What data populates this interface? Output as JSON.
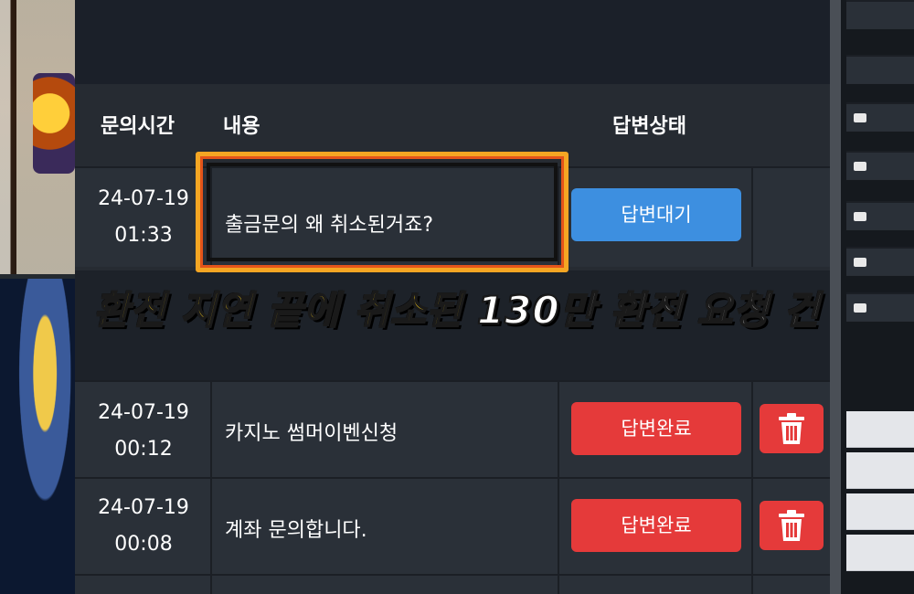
{
  "header": {
    "time_label": "문의시간",
    "content_label": "내용",
    "status_label": "답변상태"
  },
  "rows": [
    {
      "date": "24-07-19",
      "time": "01:33",
      "content": "출금문의 왜 취소된거죠?",
      "status": "답변대기",
      "status_color": "#3d8fe0",
      "deletable": false
    },
    {
      "date": "24-07-19",
      "time": "00:12",
      "content": "카지노 썸머이벤신청",
      "status": "답변완료",
      "status_color": "#e53a3a",
      "deletable": true
    },
    {
      "date": "24-07-19",
      "time": "00:08",
      "content": "계좌 문의합니다.",
      "status": "답변완료",
      "status_color": "#e53a3a",
      "deletable": true
    }
  ],
  "caption": {
    "yellow_part": "환전 지연 끝에 취소된",
    "white_part": "130만 환전 요청 건"
  },
  "icons": {
    "delete": "trash-icon"
  },
  "colors": {
    "highlight": "#f5a623",
    "caption_yellow": "#ffd21a",
    "wait": "#3d8fe0",
    "done": "#e53a3a"
  }
}
